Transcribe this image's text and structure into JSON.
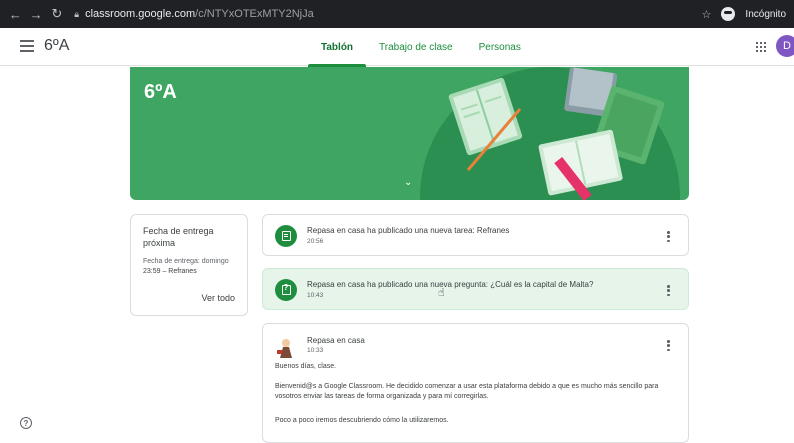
{
  "browser": {
    "url_host": "classroom.google.com",
    "url_path": "/c/NTYxOTExMTY2NjJa",
    "incognito_label": "Incógnito",
    "icons": [
      "back-icon",
      "forward-icon",
      "reload-icon",
      "lock-icon",
      "star-icon",
      "incognito-icon"
    ]
  },
  "header": {
    "class_name": "6ºA",
    "tabs": [
      {
        "label": "Tablón",
        "active": true
      },
      {
        "label": "Trabajo de clase",
        "active": false
      },
      {
        "label": "Personas",
        "active": false
      }
    ],
    "avatar_letter": "D",
    "accent_color": "#1e8e3e"
  },
  "banner": {
    "title": "6ºA",
    "color": "#3ea562"
  },
  "upcoming": {
    "title": "Fecha de entrega próxima",
    "due_label": "Fecha de entrega: domingo",
    "due_task": "23:59 – Refranes",
    "view_all": "Ver todo"
  },
  "stream": {
    "posts": [
      {
        "text": "Repasa en casa ha publicado una nueva tarea: Refranes",
        "time": "20:56",
        "icon": "assignment-icon"
      },
      {
        "text": "Repasa en casa ha publicado una nueva pregunta: ¿Cuál es la capital de Malta?",
        "time": "10:43",
        "icon": "question-icon"
      }
    ],
    "announcement": {
      "author": "Repasa en casa",
      "time": "10:33",
      "paragraphs": [
        "Buenos días, clase.",
        "Bienvenid@s a Google Classroom. He decidido comenzar a usar esta plataforma debido a que es mucho más sencillo para vosotros enviar las tareas de forma organizada y para mí corregirlas.",
        "Poco a poco iremos descubriendo cómo la utilizaremos."
      ]
    }
  }
}
